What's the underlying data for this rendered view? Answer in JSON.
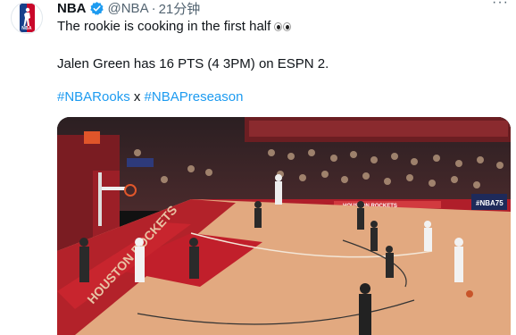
{
  "tweet": {
    "author_name": "NBA",
    "handle": "@NBA",
    "separator": "·",
    "time": "21分钟",
    "more_label": "···",
    "line1": "The rookie is cooking in the first half",
    "line2": "Jalen Green has 16 PTS (4 3PM) on ESPN 2.",
    "hashtag1": "#NBARooks",
    "between": " x ",
    "hashtag2": "#NBAPreseason"
  },
  "avatar": {
    "logo_text": "NBA"
  },
  "video": {
    "banner_text": "HOUSTON ROCKETS",
    "board_text": "#NBA75",
    "baseline_text": "HOUSTON ROCKETS"
  },
  "colors": {
    "accent": "#1d9bf0",
    "verified": "#1d9bf0",
    "nba_red": "#c9082a",
    "nba_blue": "#17408b"
  }
}
